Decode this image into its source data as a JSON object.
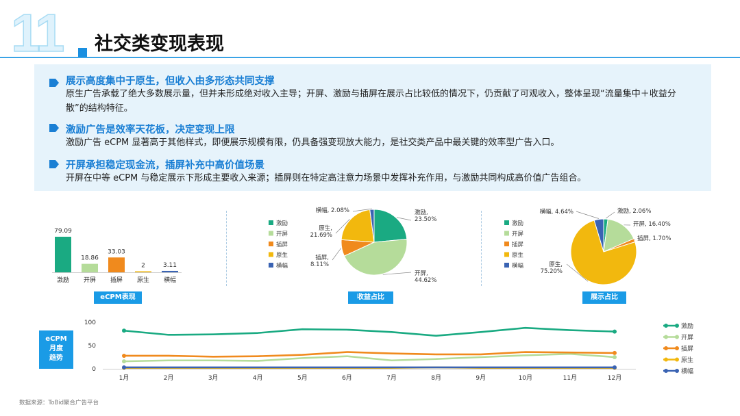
{
  "header": {
    "number": "11",
    "title": "社交类变现表现"
  },
  "summary": [
    {
      "heading": "展示高度集中于原生，但收入由多形态共同支撑",
      "body": "原生广告承载了绝大多数展示量，但并未形成绝对收入主导；开屏、激励与插屏在展示占比较低的情况下，仍贡献了可观收入，整体呈现“流量集中＋收益分散”的结构特征。"
    },
    {
      "heading": "激励广告是效率天花板，决定变现上限",
      "body": "激励广告 eCPM 显著高于其他样式，即便展示规模有限，仍具备强变现放大能力，是社交类产品中最关键的效率型广告入口。"
    },
    {
      "heading": "开屏承担稳定现金流，插屏补充中高价值场景",
      "body": "开屏在中等 eCPM 与稳定展示下形成主要收入来源；插屏则在特定高注意力场景中发挥补充作用，与激励共同构成高价值广告组合。"
    }
  ],
  "colors": {
    "激励": "#1aaa82",
    "开屏": "#b5dc9a",
    "插屏": "#f08a1d",
    "原生": "#f2b80e",
    "横幅": "#3a63b3",
    "accent": "#1a9be6"
  },
  "legend_items": [
    "激励",
    "开屏",
    "插屏",
    "原生",
    "横幅"
  ],
  "tags": {
    "ecpm": "eCPM表现",
    "revenue": "收益占比",
    "display": "展示占比",
    "trend": "eCPM\n月度\n趋势"
  },
  "chart_data": [
    {
      "type": "bar",
      "title": "eCPM表现",
      "categories": [
        "激励",
        "开屏",
        "插屏",
        "原生",
        "横幅"
      ],
      "values": [
        79.09,
        18.86,
        33.03,
        2,
        3.11
      ],
      "value_labels": [
        "79.09",
        "18.86",
        "33.03",
        "2",
        "3.11"
      ]
    },
    {
      "type": "pie",
      "title": "收益占比",
      "labels": [
        "激励",
        "开屏",
        "插屏",
        "原生",
        "横幅"
      ],
      "values": [
        23.5,
        44.62,
        8.11,
        21.69,
        2.08
      ],
      "display_labels": [
        "23.50%",
        "44.62%",
        "8.11%",
        "21.69%",
        "2.08%"
      ]
    },
    {
      "type": "pie",
      "title": "展示占比",
      "labels": [
        "激励",
        "开屏",
        "插屏",
        "原生",
        "横幅"
      ],
      "values": [
        2.06,
        16.4,
        1.7,
        75.2,
        4.64
      ],
      "display_labels": [
        "2.06%",
        "16.40%",
        "1.70%",
        "75.20%",
        "4.64%"
      ]
    },
    {
      "type": "line",
      "title": "eCPM 月度趋势",
      "x": [
        "1月",
        "2月",
        "3月",
        "4月",
        "5月",
        "6月",
        "7月",
        "8月",
        "9月",
        "10月",
        "11月",
        "12月"
      ],
      "ylim": [
        0,
        100
      ],
      "yticks": [
        "0",
        "50",
        "100"
      ],
      "grid": false,
      "legend": "right",
      "series": [
        {
          "name": "激励",
          "values": [
            82,
            73,
            74,
            77,
            85,
            84,
            79,
            71,
            79,
            88,
            83,
            80
          ]
        },
        {
          "name": "开屏",
          "values": [
            16,
            18,
            18,
            17,
            23,
            27,
            18,
            21,
            25,
            29,
            32,
            25
          ]
        },
        {
          "name": "插屏",
          "values": [
            28,
            28,
            26,
            27,
            30,
            36,
            33,
            31,
            31,
            36,
            35,
            34
          ]
        },
        {
          "name": "原生",
          "values": [
            2,
            2,
            2,
            2,
            2,
            2,
            2,
            3,
            2,
            2,
            2,
            2
          ]
        },
        {
          "name": "横幅",
          "values": [
            3,
            3,
            3,
            3,
            3,
            3,
            3,
            3,
            3,
            3,
            3,
            3
          ]
        }
      ]
    }
  ],
  "source": "数据来源：ToBid聚合广告平台"
}
